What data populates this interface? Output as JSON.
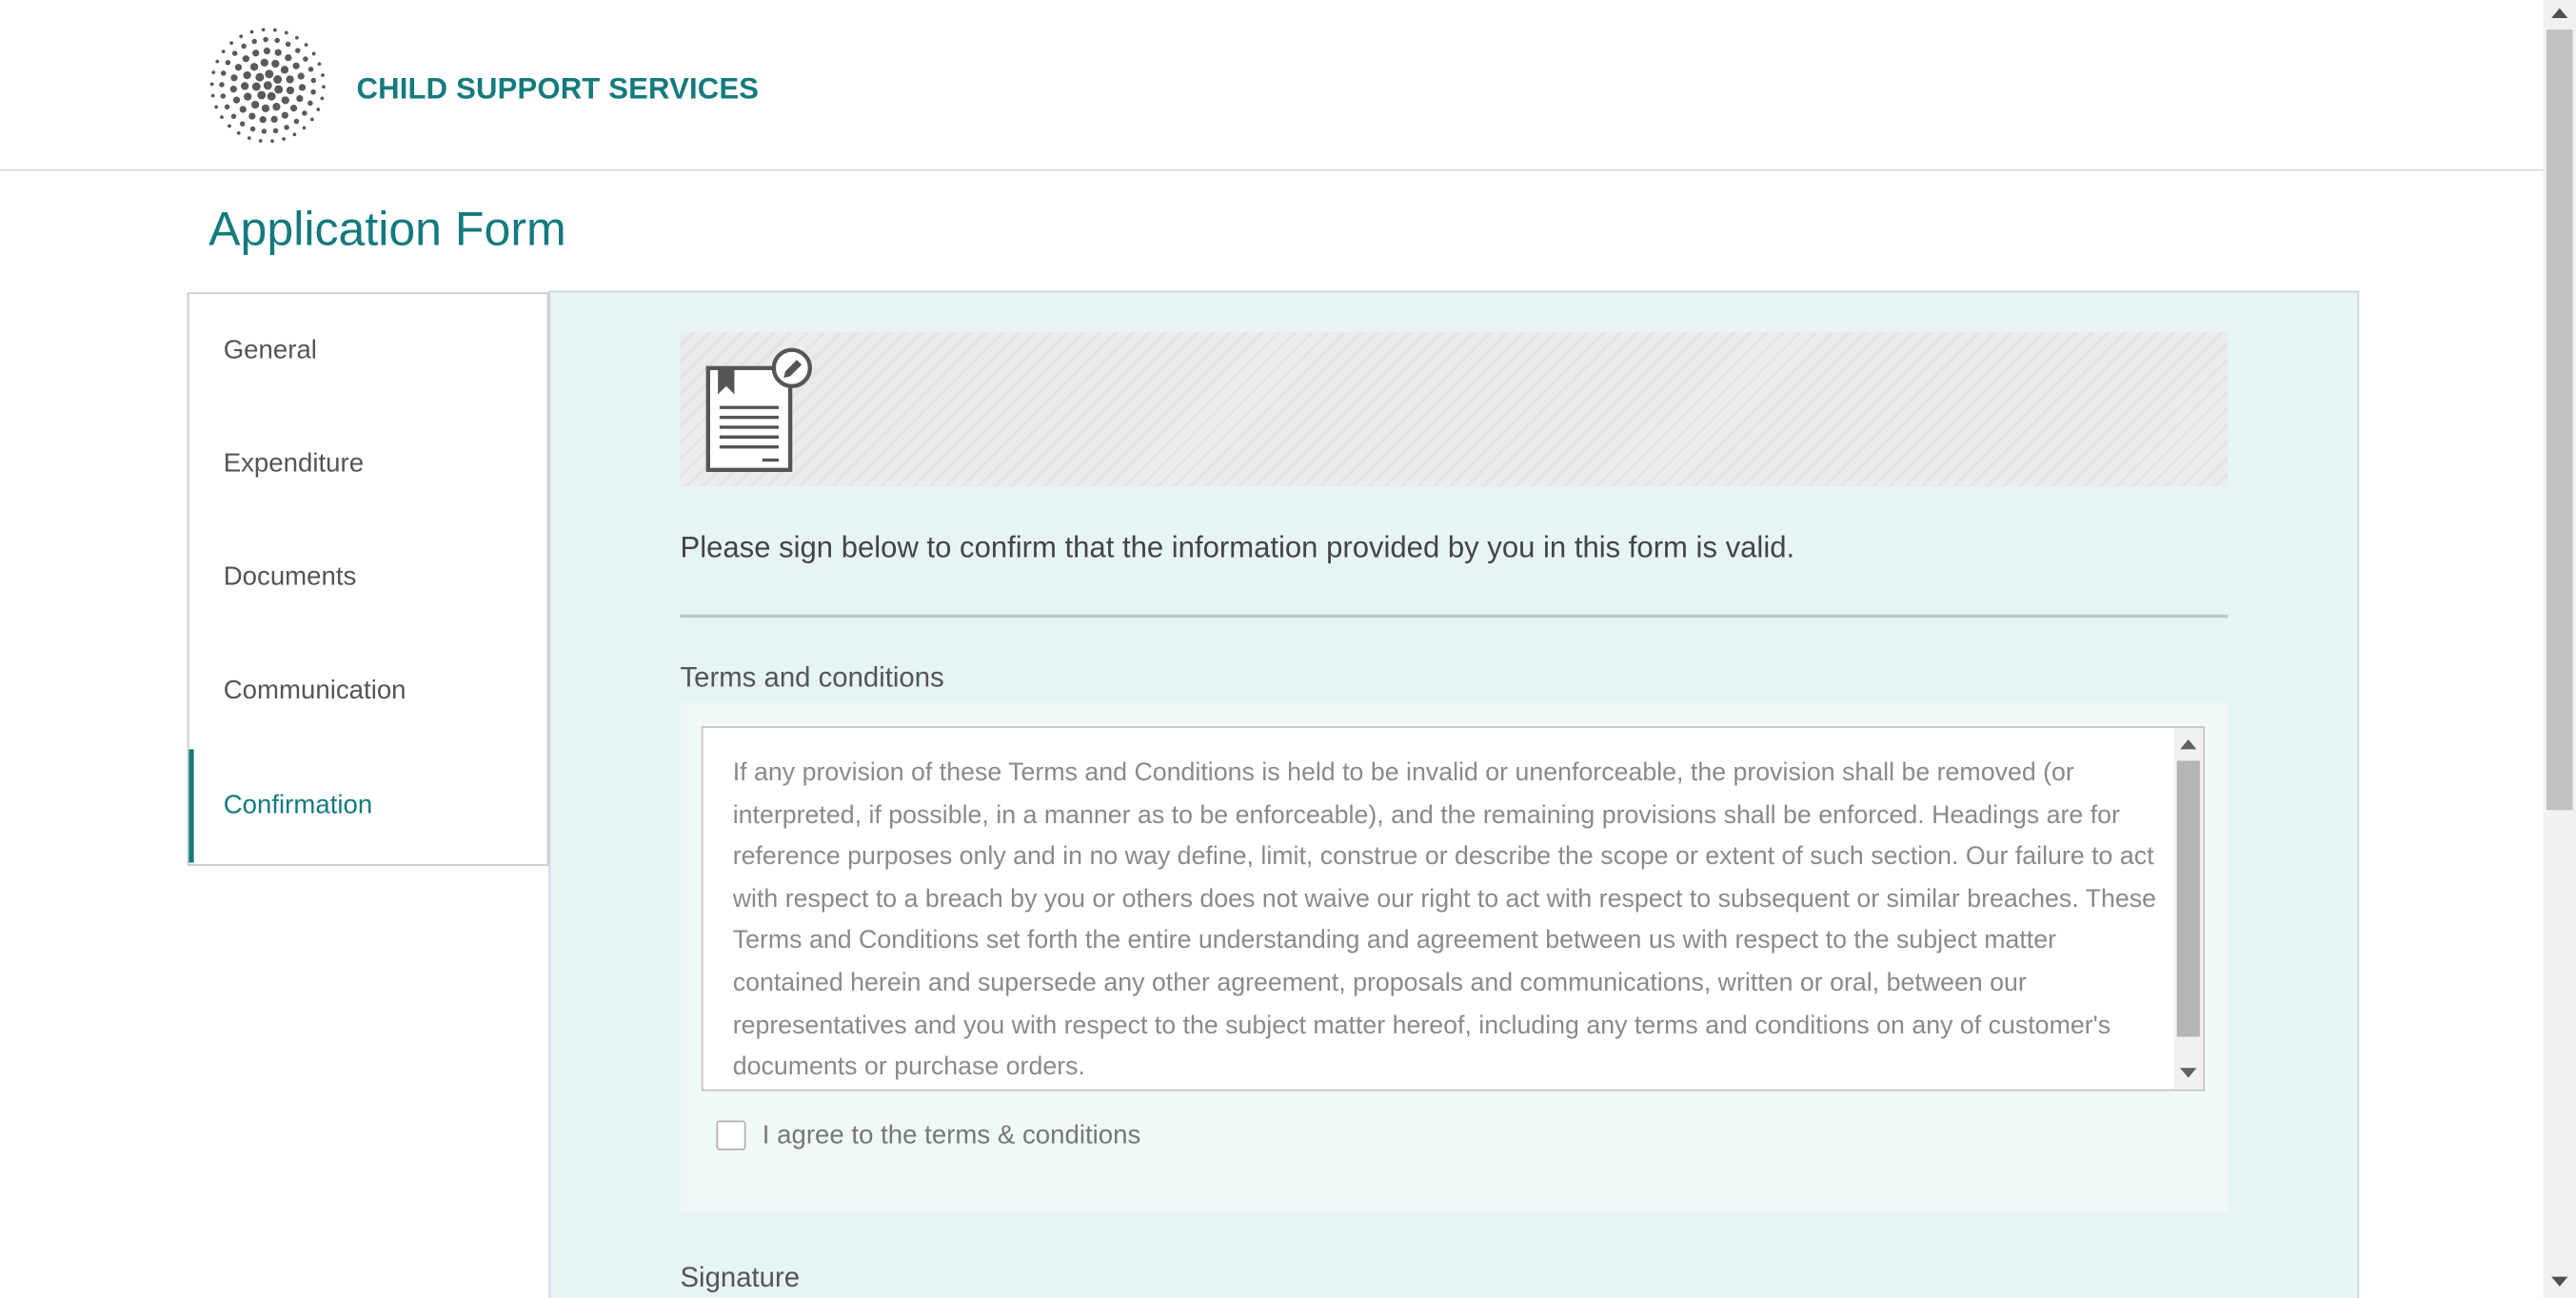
{
  "header": {
    "brand_name": "CHILD SUPPORT SERVICES",
    "logo_icon": "dotted-sphere-logo"
  },
  "page": {
    "title": "Application Form"
  },
  "sidebar": {
    "items": [
      {
        "label": "General",
        "active": false
      },
      {
        "label": "Expenditure",
        "active": false
      },
      {
        "label": "Documents",
        "active": false
      },
      {
        "label": "Communication",
        "active": false
      },
      {
        "label": "Confirmation",
        "active": true
      }
    ]
  },
  "confirmation": {
    "banner_icon": "signed-document-icon",
    "intro_text": "Please sign below to confirm that the information provided by you in this form is valid.",
    "terms_title": "Terms and conditions",
    "terms_text": "If any provision of these Terms and Conditions is held to be invalid or unenforceable, the provision shall be removed (or interpreted, if possible, in a manner as to be enforceable), and the remaining provisions shall be enforced. Headings are for reference purposes only and in no way define, limit, construe or describe the scope or extent of such section. Our failure to act with respect to a breach by you or others does not waive our right to act with respect to subsequent or similar breaches. These Terms and Conditions set forth the entire understanding and agreement between us with respect to the subject matter contained herein and supersede any other agreement, proposals and communications, written or oral, between our representatives and you with respect to the subject matter hereof, including any terms and conditions on any of customer's documents or purchase orders.",
    "agree_label": "I agree to the terms & conditions",
    "agree_checked": false,
    "signature_title": "Signature"
  },
  "colors": {
    "brand": "#147a80",
    "content_bg": "#e6f4f5",
    "panel_bg": "#f1f8f8"
  }
}
